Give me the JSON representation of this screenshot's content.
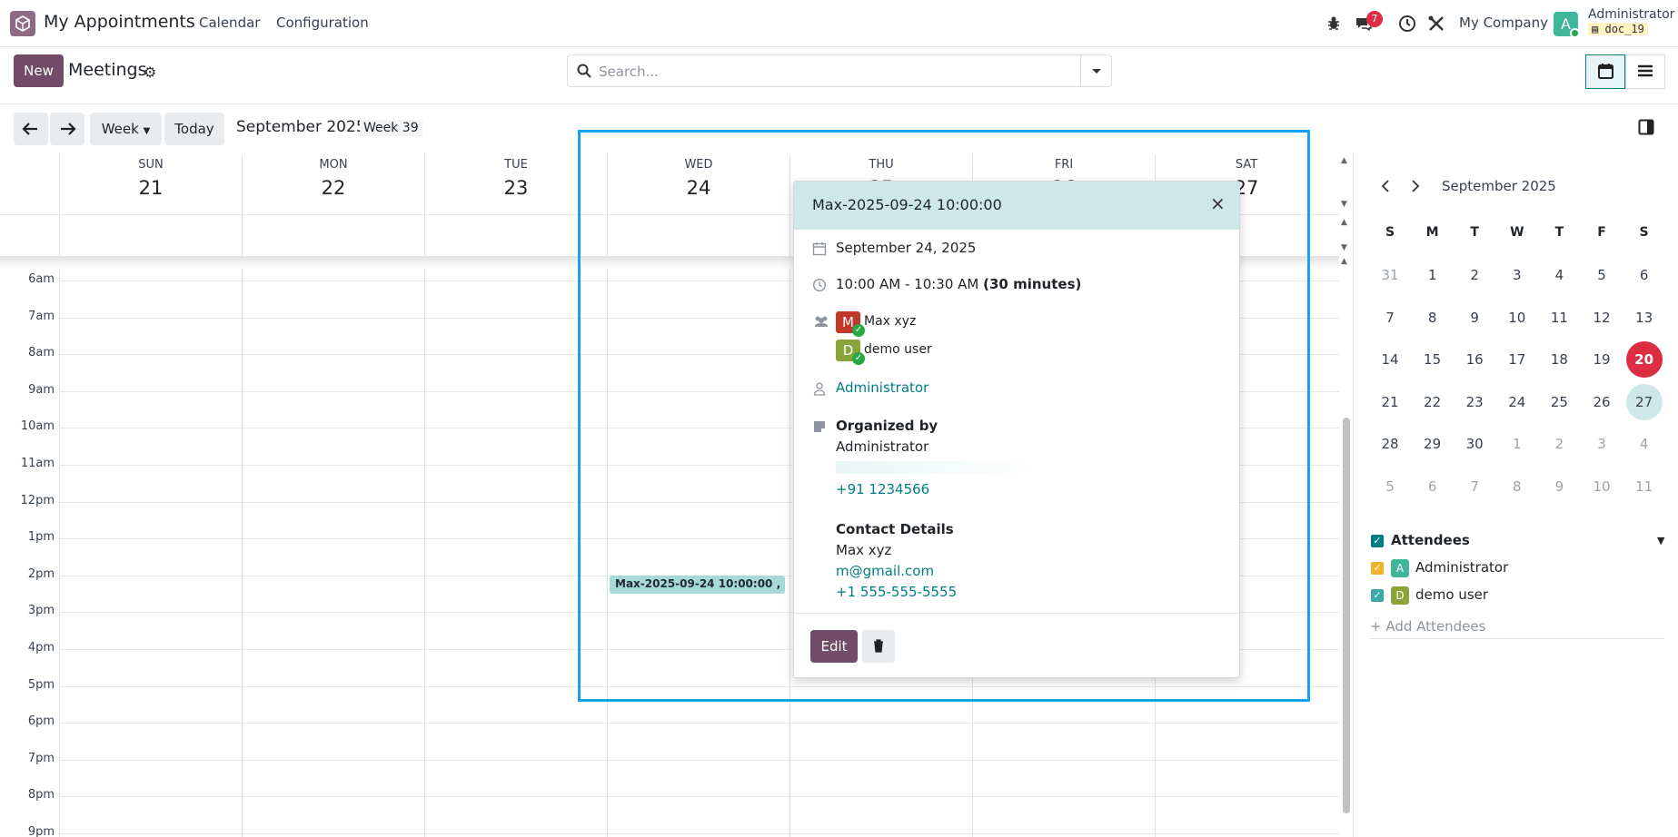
{
  "topnav": {
    "app_name": "My Appointments",
    "menu": [
      "Calendar",
      "Configuration"
    ],
    "messages_badge": "7",
    "company": "My Company",
    "user_initial": "A",
    "user_name": "Administrator",
    "db_name": "doc_19"
  },
  "control_panel": {
    "new_label": "New",
    "title": "Meetings",
    "search_placeholder": "Search..."
  },
  "toolbar": {
    "scale_label": "Week",
    "today_label": "Today",
    "month_label": "September 2025",
    "week_label": "Week 39"
  },
  "days": [
    {
      "name": "SUN",
      "date": "21"
    },
    {
      "name": "MON",
      "date": "22"
    },
    {
      "name": "TUE",
      "date": "23"
    },
    {
      "name": "WED",
      "date": "24"
    },
    {
      "name": "THU",
      "date": "25"
    },
    {
      "name": "FRI",
      "date": "26"
    },
    {
      "name": "SAT",
      "date": "27"
    }
  ],
  "hours": [
    "6am",
    "7am",
    "8am",
    "9am",
    "10am",
    "11am",
    "12pm",
    "1pm",
    "2pm",
    "3pm",
    "4pm",
    "5pm",
    "6pm",
    "7pm",
    "8pm",
    "9pm"
  ],
  "event": {
    "label": "Max-2025-09-24 10:00:00 , ..."
  },
  "popover": {
    "title": "Max-2025-09-24 10:00:00",
    "date": "September 24, 2025",
    "time": "10:00 AM - 10:30 AM",
    "duration": "(30 minutes)",
    "attendees": [
      {
        "initial": "M",
        "name": "Max xyz",
        "color": "#c0392b"
      },
      {
        "initial": "D",
        "name": "demo user",
        "color": "#8aa43a"
      }
    ],
    "responsible": "Administrator",
    "organized_label": "Organized by",
    "organizer": "Administrator",
    "organizer_phone": "+91 1234566",
    "contact_label": "Contact Details",
    "contact_name": "Max xyz",
    "contact_email": "m@gmail.com",
    "contact_phone": "+1 555-555-5555",
    "edit_label": "Edit"
  },
  "mini_calendar": {
    "month": "September 2025",
    "dow": [
      "S",
      "M",
      "T",
      "W",
      "T",
      "F",
      "S"
    ],
    "weeks": [
      [
        "31",
        "1",
        "2",
        "3",
        "4",
        "5",
        "6"
      ],
      [
        "7",
        "8",
        "9",
        "10",
        "11",
        "12",
        "13"
      ],
      [
        "14",
        "15",
        "16",
        "17",
        "18",
        "19",
        "20"
      ],
      [
        "21",
        "22",
        "23",
        "24",
        "25",
        "26",
        "27"
      ],
      [
        "28",
        "29",
        "30",
        "1",
        "2",
        "3",
        "4"
      ],
      [
        "5",
        "6",
        "7",
        "8",
        "9",
        "10",
        "11"
      ]
    ],
    "today": "20",
    "selected": "27"
  },
  "filters": {
    "attendees_label": "Attendees",
    "items": [
      {
        "initial": "A",
        "name": "Administrator",
        "color": "#3fb59a",
        "check_color": "#f0b429"
      },
      {
        "initial": "D",
        "name": "demo user",
        "color": "#8aa43a",
        "check_color": "#3fa9a6"
      }
    ],
    "add_label": "+ Add Attendees"
  }
}
